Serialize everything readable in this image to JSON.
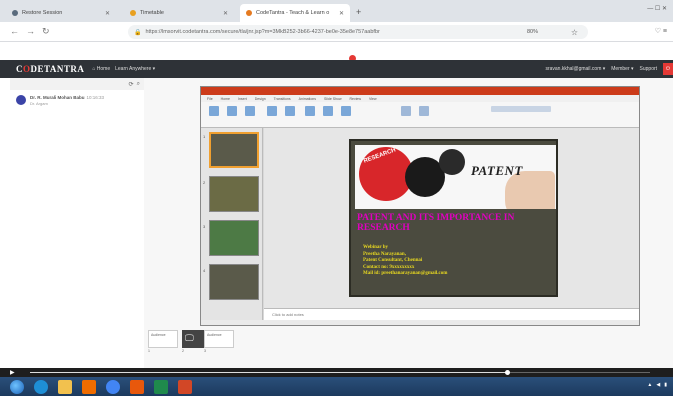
{
  "browser": {
    "tabs": [
      {
        "label": "Restore Session",
        "active": false,
        "color": "#5a6b7d"
      },
      {
        "label": "Timetable",
        "active": false,
        "color": "#e8a020"
      },
      {
        "label": "CodeTantra - Teach & Learn o",
        "active": true,
        "color": "#e57a20"
      }
    ],
    "new_tab": "+",
    "url": "https://lmsorvit.codetantra.com/secure/tla/jnr.jsp?m=3MkB252-3b66-4237-be0e-35e8e757aabfbr",
    "zoom": "80%"
  },
  "app": {
    "logo_part1": "C",
    "logo_o": "O",
    "logo_part2": "DETANTRA",
    "nav": [
      "⌂ Home",
      "Learn Anywhere ▾"
    ],
    "user_email": "sravan.kkhal@gmail.com ▾",
    "menu_items": [
      "Member ▾",
      "Support"
    ],
    "accent": "#e53935"
  },
  "chat": {
    "participant_name": "Dr. R. Murali Mohan Babu",
    "participant_time": "10:16:33",
    "participant_role": "Dr. Argam"
  },
  "presentation": {
    "notes_placeholder": "Click to add notes",
    "slide_title": "PATENT AND ITS IMPORTANCE IN RESEARCH",
    "patent_word": "PATENT",
    "research_word": "RESEARCH",
    "webinar_lines": [
      "Webinar by",
      "Preetha Narayanan,",
      "Patent Consultant, Chennai",
      "Contact no: 9xxxxxxxxx",
      "Mail id: preethanarayanan@gmail.com"
    ],
    "thumb_numbers": [
      "1",
      "2",
      "3",
      "4"
    ]
  },
  "strip": {
    "items": [
      {
        "label": "Audience",
        "num": "1"
      },
      {
        "label": "",
        "num": "2"
      },
      {
        "label": "Audience",
        "num": "3"
      }
    ]
  },
  "video": {
    "progress": 0.77
  }
}
